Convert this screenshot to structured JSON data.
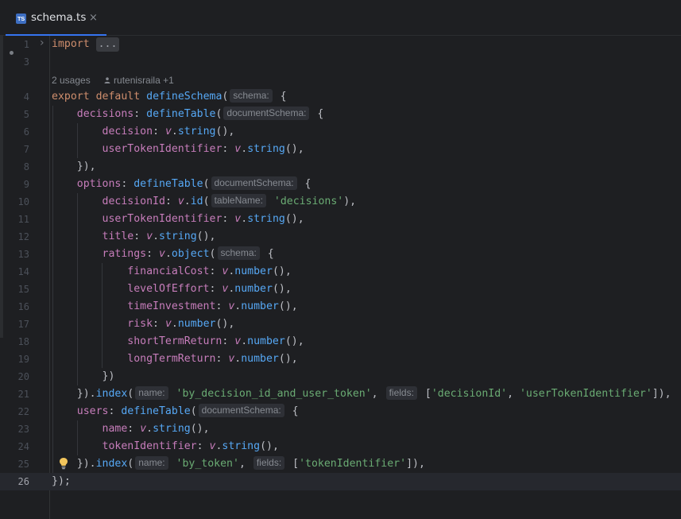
{
  "tab": {
    "icon": "TS",
    "title": "schema.ts",
    "close_glyph": "×"
  },
  "gutter_dot_icon": "modified-marker-icon",
  "fold_icon": "chevron-right-icon",
  "usages": {
    "count_label": "2 usages",
    "author_label": "rutenisraila +1",
    "author_icon": "person-icon"
  },
  "intention_icon": "lightbulb-icon",
  "current_line": 26,
  "colors": {
    "keyword": "#cf8e6d",
    "function": "#56a8f5",
    "property": "#c77dbb",
    "string": "#6aab73",
    "text": "#bcbec4",
    "accent": "#3574f0"
  },
  "lines": [
    {
      "n": "1",
      "tokens": [
        [
          "kw",
          "import"
        ],
        [
          "pn",
          " "
        ],
        [
          "fold",
          "..."
        ]
      ]
    },
    {
      "n": "3",
      "tokens": []
    },
    {
      "n": "4",
      "tokens": [
        [
          "kw",
          "export"
        ],
        [
          "pn",
          " "
        ],
        [
          "kw",
          "default"
        ],
        [
          "pn",
          " "
        ],
        [
          "fn",
          "defineSchema"
        ],
        [
          "pn",
          "("
        ],
        [
          "hint",
          "schema:"
        ],
        [
          "pn",
          " {"
        ]
      ]
    },
    {
      "n": "5",
      "tokens": [
        [
          "pn",
          "    "
        ],
        [
          "prop",
          "decisions"
        ],
        [
          "pn",
          ": "
        ],
        [
          "fn",
          "defineTable"
        ],
        [
          "pn",
          "("
        ],
        [
          "hint",
          "documentSchema:"
        ],
        [
          "pn",
          " {"
        ]
      ]
    },
    {
      "n": "6",
      "tokens": [
        [
          "pn",
          "        "
        ],
        [
          "prop",
          "decision"
        ],
        [
          "pn",
          ": "
        ],
        [
          "v",
          "v"
        ],
        [
          "pn",
          "."
        ],
        [
          "fn",
          "string"
        ],
        [
          "pn",
          "(),"
        ]
      ]
    },
    {
      "n": "7",
      "tokens": [
        [
          "pn",
          "        "
        ],
        [
          "prop",
          "userTokenIdentifier"
        ],
        [
          "pn",
          ": "
        ],
        [
          "v",
          "v"
        ],
        [
          "pn",
          "."
        ],
        [
          "fn",
          "string"
        ],
        [
          "pn",
          "(),"
        ]
      ]
    },
    {
      "n": "8",
      "tokens": [
        [
          "pn",
          "    }),"
        ]
      ]
    },
    {
      "n": "9",
      "tokens": [
        [
          "pn",
          "    "
        ],
        [
          "prop",
          "options"
        ],
        [
          "pn",
          ": "
        ],
        [
          "fn",
          "defineTable"
        ],
        [
          "pn",
          "("
        ],
        [
          "hint",
          "documentSchema:"
        ],
        [
          "pn",
          " {"
        ]
      ]
    },
    {
      "n": "10",
      "tokens": [
        [
          "pn",
          "        "
        ],
        [
          "prop",
          "decisionId"
        ],
        [
          "pn",
          ": "
        ],
        [
          "v",
          "v"
        ],
        [
          "pn",
          "."
        ],
        [
          "fn",
          "id"
        ],
        [
          "pn",
          "("
        ],
        [
          "hint",
          "tableName:"
        ],
        [
          "str",
          " 'decisions'"
        ],
        [
          "pn",
          "),"
        ]
      ]
    },
    {
      "n": "11",
      "tokens": [
        [
          "pn",
          "        "
        ],
        [
          "prop",
          "userTokenIdentifier"
        ],
        [
          "pn",
          ": "
        ],
        [
          "v",
          "v"
        ],
        [
          "pn",
          "."
        ],
        [
          "fn",
          "string"
        ],
        [
          "pn",
          "(),"
        ]
      ]
    },
    {
      "n": "12",
      "tokens": [
        [
          "pn",
          "        "
        ],
        [
          "prop",
          "title"
        ],
        [
          "pn",
          ": "
        ],
        [
          "v",
          "v"
        ],
        [
          "pn",
          "."
        ],
        [
          "fn",
          "string"
        ],
        [
          "pn",
          "(),"
        ]
      ]
    },
    {
      "n": "13",
      "tokens": [
        [
          "pn",
          "        "
        ],
        [
          "prop",
          "ratings"
        ],
        [
          "pn",
          ": "
        ],
        [
          "v",
          "v"
        ],
        [
          "pn",
          "."
        ],
        [
          "fn",
          "object"
        ],
        [
          "pn",
          "("
        ],
        [
          "hint",
          "schema:"
        ],
        [
          "pn",
          " {"
        ]
      ]
    },
    {
      "n": "14",
      "tokens": [
        [
          "pn",
          "            "
        ],
        [
          "prop",
          "financialCost"
        ],
        [
          "pn",
          ": "
        ],
        [
          "v",
          "v"
        ],
        [
          "pn",
          "."
        ],
        [
          "fn",
          "number"
        ],
        [
          "pn",
          "(),"
        ]
      ]
    },
    {
      "n": "15",
      "tokens": [
        [
          "pn",
          "            "
        ],
        [
          "prop",
          "levelOfEffort"
        ],
        [
          "pn",
          ": "
        ],
        [
          "v",
          "v"
        ],
        [
          "pn",
          "."
        ],
        [
          "fn",
          "number"
        ],
        [
          "pn",
          "(),"
        ]
      ]
    },
    {
      "n": "16",
      "tokens": [
        [
          "pn",
          "            "
        ],
        [
          "prop",
          "timeInvestment"
        ],
        [
          "pn",
          ": "
        ],
        [
          "v",
          "v"
        ],
        [
          "pn",
          "."
        ],
        [
          "fn",
          "number"
        ],
        [
          "pn",
          "(),"
        ]
      ]
    },
    {
      "n": "17",
      "tokens": [
        [
          "pn",
          "            "
        ],
        [
          "prop",
          "risk"
        ],
        [
          "pn",
          ": "
        ],
        [
          "v",
          "v"
        ],
        [
          "pn",
          "."
        ],
        [
          "fn",
          "number"
        ],
        [
          "pn",
          "(),"
        ]
      ]
    },
    {
      "n": "18",
      "tokens": [
        [
          "pn",
          "            "
        ],
        [
          "prop",
          "shortTermReturn"
        ],
        [
          "pn",
          ": "
        ],
        [
          "v",
          "v"
        ],
        [
          "pn",
          "."
        ],
        [
          "fn",
          "number"
        ],
        [
          "pn",
          "(),"
        ]
      ]
    },
    {
      "n": "19",
      "tokens": [
        [
          "pn",
          "            "
        ],
        [
          "prop",
          "longTermReturn"
        ],
        [
          "pn",
          ": "
        ],
        [
          "v",
          "v"
        ],
        [
          "pn",
          "."
        ],
        [
          "fn",
          "number"
        ],
        [
          "pn",
          "(),"
        ]
      ]
    },
    {
      "n": "20",
      "tokens": [
        [
          "pn",
          "        })"
        ]
      ]
    },
    {
      "n": "21",
      "tokens": [
        [
          "pn",
          "    })."
        ],
        [
          "fn",
          "index"
        ],
        [
          "pn",
          "("
        ],
        [
          "hint",
          "name:"
        ],
        [
          "str",
          " 'by_decision_id_and_user_token'"
        ],
        [
          "pn",
          ", "
        ],
        [
          "hint",
          "fields:"
        ],
        [
          "pn",
          " ["
        ],
        [
          "str",
          "'decisionId'"
        ],
        [
          "pn",
          ", "
        ],
        [
          "str",
          "'userTokenIdentifier'"
        ],
        [
          "pn",
          "]),"
        ]
      ]
    },
    {
      "n": "22",
      "tokens": [
        [
          "pn",
          "    "
        ],
        [
          "prop",
          "users"
        ],
        [
          "pn",
          ": "
        ],
        [
          "fn",
          "defineTable"
        ],
        [
          "pn",
          "("
        ],
        [
          "hint",
          "documentSchema:"
        ],
        [
          "pn",
          " {"
        ]
      ]
    },
    {
      "n": "23",
      "tokens": [
        [
          "pn",
          "        "
        ],
        [
          "prop",
          "name"
        ],
        [
          "pn",
          ": "
        ],
        [
          "v",
          "v"
        ],
        [
          "pn",
          "."
        ],
        [
          "fn",
          "string"
        ],
        [
          "pn",
          "(),"
        ]
      ]
    },
    {
      "n": "24",
      "tokens": [
        [
          "pn",
          "        "
        ],
        [
          "prop",
          "tokenIdentifier"
        ],
        [
          "pn",
          ": "
        ],
        [
          "v",
          "v"
        ],
        [
          "pn",
          "."
        ],
        [
          "fn",
          "string"
        ],
        [
          "pn",
          "(),"
        ]
      ]
    },
    {
      "n": "25",
      "tokens": [
        [
          "pn",
          "    })."
        ],
        [
          "fn",
          "index"
        ],
        [
          "pn",
          "("
        ],
        [
          "hint",
          "name:"
        ],
        [
          "str",
          " 'by_token'"
        ],
        [
          "pn",
          ", "
        ],
        [
          "hint",
          "fields:"
        ],
        [
          "pn",
          " ["
        ],
        [
          "str",
          "'tokenIdentifier'"
        ],
        [
          "pn",
          "]),"
        ]
      ]
    },
    {
      "n": "26",
      "tokens": [
        [
          "pn",
          "});"
        ]
      ]
    }
  ]
}
